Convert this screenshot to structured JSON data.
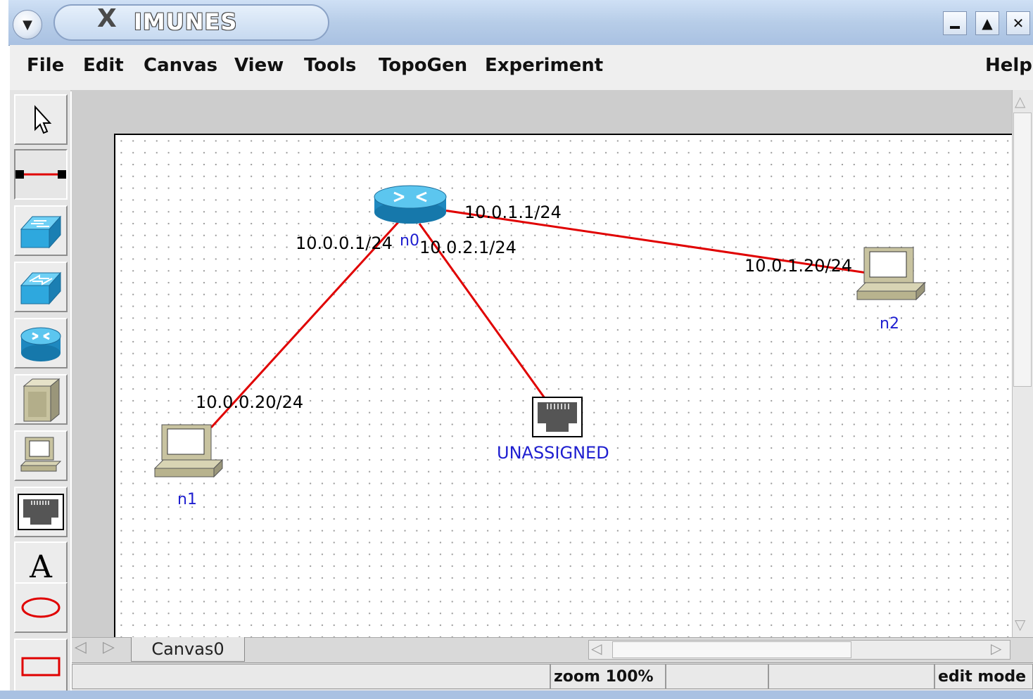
{
  "window": {
    "title": "IMUNES",
    "title_glyph": "X",
    "menu_button_icon": "chevron-down-icon",
    "controls": [
      "minimize-icon",
      "maximize-icon",
      "close-icon"
    ]
  },
  "menubar": {
    "items": [
      "File",
      "Edit",
      "Canvas",
      "View",
      "Tools",
      "TopoGen",
      "Experiment"
    ],
    "help": "Help"
  },
  "toolbox": {
    "tools": [
      {
        "name": "select-tool",
        "icon": "pointer-arrow-icon"
      },
      {
        "name": "link-tool",
        "icon": "link-icon",
        "selected": true
      },
      {
        "name": "hub-tool",
        "icon": "hub-icon"
      },
      {
        "name": "switch-tool",
        "icon": "switch-icon"
      },
      {
        "name": "router-tool",
        "icon": "router-icon"
      },
      {
        "name": "host-tool",
        "icon": "host-server-icon"
      },
      {
        "name": "pc-tool",
        "icon": "pc-icon"
      },
      {
        "name": "rj45-tool",
        "icon": "rj45-icon"
      },
      {
        "name": "text-tool",
        "icon": "text-icon",
        "glyph": "A"
      },
      {
        "name": "oval-tool",
        "icon": "oval-icon"
      },
      {
        "name": "rectangle-tool",
        "icon": "rectangle-icon"
      }
    ]
  },
  "topology": {
    "nodes": {
      "n0": {
        "label": "n0",
        "type": "router"
      },
      "n1": {
        "label": "n1",
        "type": "pc"
      },
      "n2": {
        "label": "n2",
        "type": "pc"
      },
      "rj45": {
        "label": "UNASSIGNED",
        "type": "rj45"
      }
    },
    "addresses": {
      "n0_n1": "10.0.0.1/24",
      "n1": "10.0.0.20/24",
      "n0_n2": "10.0.1.1/24",
      "n2": "10.0.1.20/24",
      "n0_rj45": "10.0.2.1/24"
    },
    "link_color": "#e00000",
    "label_color": "#1e1ed0"
  },
  "tabs": {
    "canvas_tab": "Canvas0",
    "nav": [
      "tab-prev-icon",
      "tab-next-icon"
    ]
  },
  "statusbar": {
    "zoom": "zoom 100%",
    "mode": "edit mode"
  }
}
